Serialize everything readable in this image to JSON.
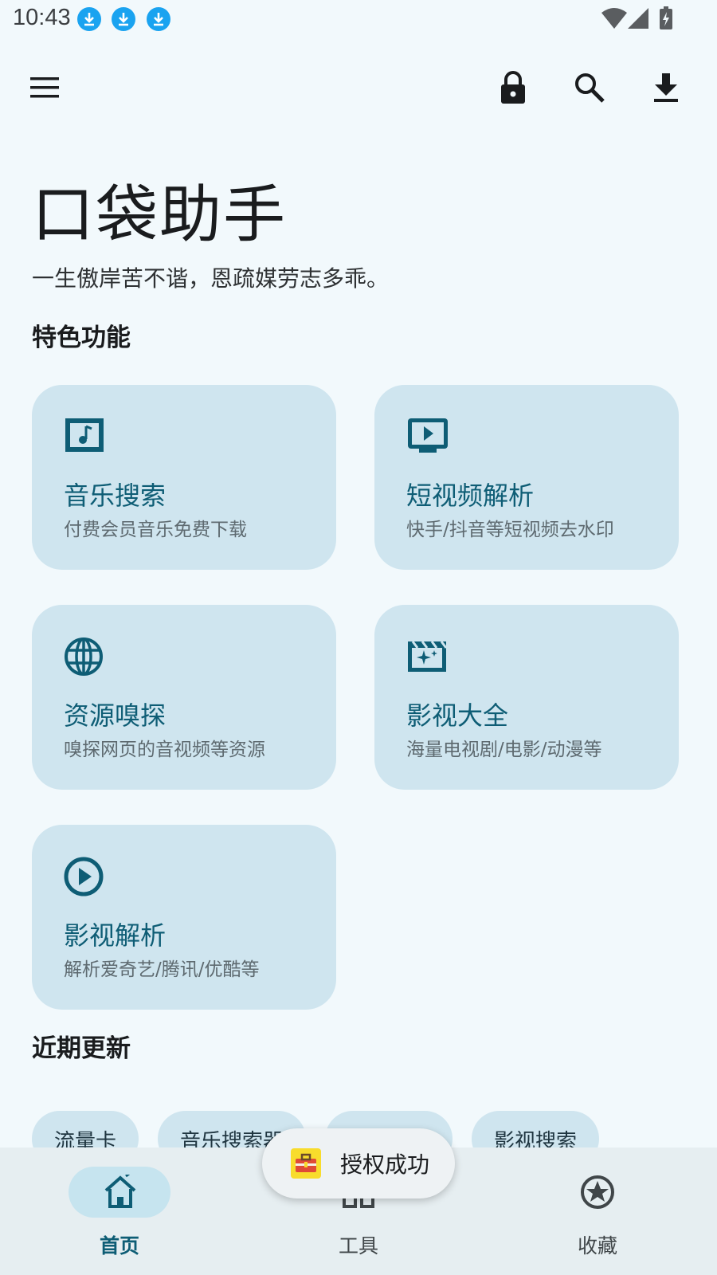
{
  "status_bar": {
    "time": "10:43",
    "notification_icons": [
      "download-icon",
      "download-icon",
      "download-icon"
    ],
    "right_icons": [
      "wifi-icon",
      "signal-icon",
      "battery-charging-icon"
    ]
  },
  "app_bar": {
    "left_icon": "menu-icon",
    "right_icons": [
      "lock-icon",
      "search-icon",
      "download-icon"
    ]
  },
  "hero": {
    "title": "口袋助手",
    "subtitle": "一生傲岸苦不谐，恩疏媒劳志多乖。"
  },
  "features": {
    "section_title": "特色功能",
    "items": [
      {
        "title": "音乐搜索",
        "desc": "付费会员音乐免费下载",
        "icon": "music-note-icon"
      },
      {
        "title": "短视频解析",
        "desc": "快手/抖音等短视频去水印",
        "icon": "tv-play-icon"
      },
      {
        "title": "资源嗅探",
        "desc": "嗅探网页的音视频等资源",
        "icon": "globe-icon"
      },
      {
        "title": "影视大全",
        "desc": "海量电视剧/电影/动漫等",
        "icon": "movie-clapper-icon"
      },
      {
        "title": "影视解析",
        "desc": "解析爱奇艺/腾讯/优酷等",
        "icon": "play-circle-icon"
      }
    ]
  },
  "recent": {
    "section_title": "近期更新",
    "chips": [
      "流量卡",
      "音乐搜索器",
      "",
      "影视搜索"
    ]
  },
  "toast": {
    "text": "授权成功",
    "icon": "toolbox-icon"
  },
  "bottom_nav": {
    "items": [
      {
        "label": "首页",
        "icon": "home-icon",
        "selected": true
      },
      {
        "label": "工具",
        "icon": "grid-icon",
        "selected": false
      },
      {
        "label": "收藏",
        "icon": "star-circle-icon",
        "selected": false
      }
    ]
  },
  "colors": {
    "background": "#f2f9fc",
    "card": "#cfe5ef",
    "accent": "#0e5d75",
    "nav_background": "#e6eef1",
    "toast_icon": "#f8dc2c",
    "download_badge": "#1aa3f0"
  }
}
